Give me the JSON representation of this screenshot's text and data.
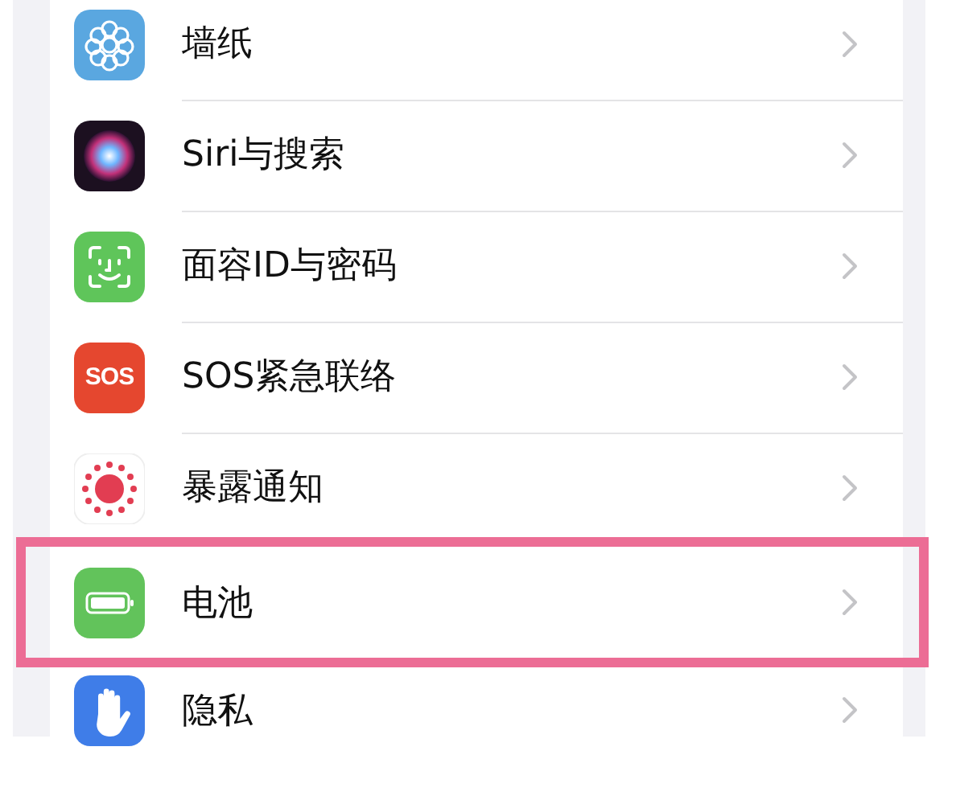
{
  "settings": [
    {
      "label": "墙纸",
      "kind": "wallpaper",
      "highlighted": false
    },
    {
      "label": "Siri与搜索",
      "kind": "siri",
      "highlighted": false
    },
    {
      "label": "面容ID与密码",
      "kind": "faceid",
      "highlighted": false
    },
    {
      "label": "SOS紧急联络",
      "kind": "sos",
      "icon_text": "SOS",
      "highlighted": false
    },
    {
      "label": "暴露通知",
      "kind": "exposure",
      "highlighted": false
    },
    {
      "label": "电池",
      "kind": "battery",
      "highlighted": true
    },
    {
      "label": "隐私",
      "kind": "privacy",
      "highlighted": false
    }
  ]
}
